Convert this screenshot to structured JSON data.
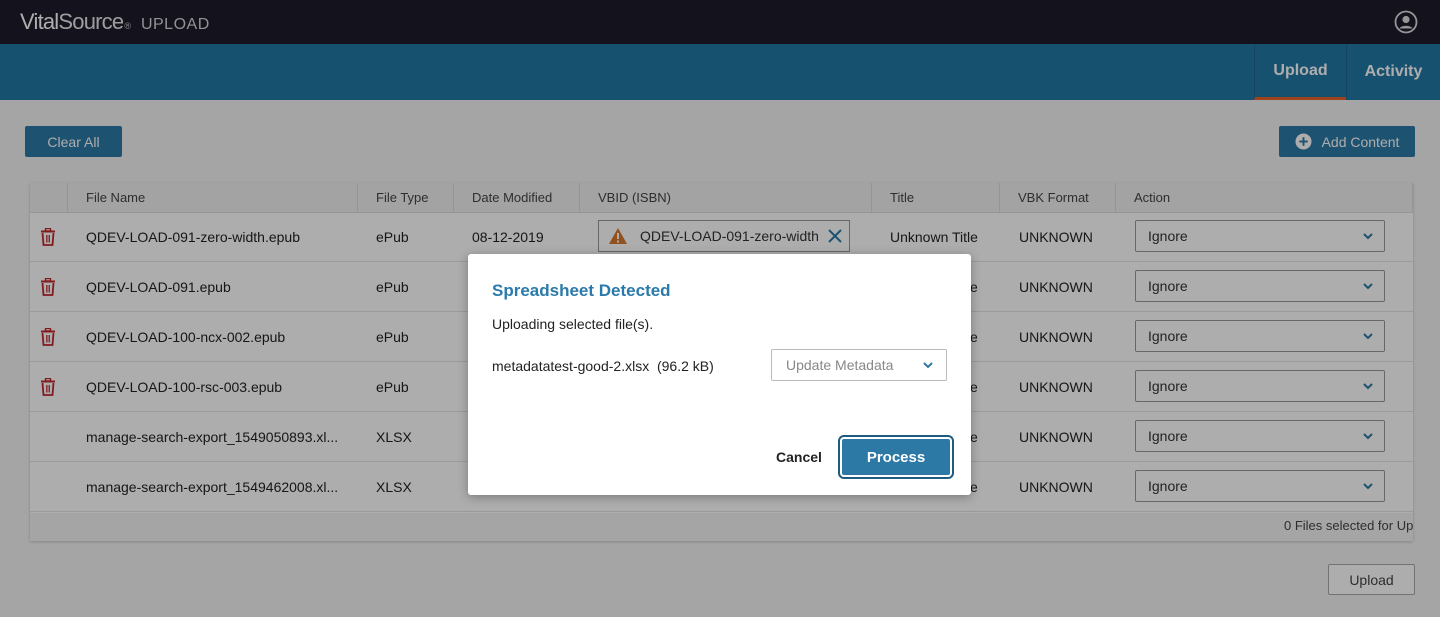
{
  "app": {
    "brand_vital": "Vital",
    "brand_source": "Source",
    "brand_tm": "®",
    "product": "UPLOAD"
  },
  "nav": {
    "tabs": [
      {
        "label": "Upload",
        "active": true
      },
      {
        "label": "Activity",
        "active": false
      }
    ]
  },
  "toolbar": {
    "clear_all_label": "Clear All",
    "add_content_label": "Add Content"
  },
  "table": {
    "columns": [
      "File Name",
      "File Type",
      "Date Modified",
      "VBID (ISBN)",
      "Title",
      "VBK Format",
      "Action"
    ],
    "rows": [
      {
        "file_name": "QDEV-LOAD-091-zero-width.epub",
        "file_type": "ePub",
        "date_modified": "08-12-2019",
        "vbid": "QDEV-LOAD-091-zero-width",
        "title": "Unknown Title",
        "vbk_format": "UNKNOWN",
        "action": "Ignore",
        "deletable": true
      },
      {
        "file_name": "QDEV-LOAD-091.epub",
        "file_type": "ePub",
        "date_modified": "",
        "vbid": "",
        "title": "e",
        "vbk_format": "UNKNOWN",
        "action": "Ignore",
        "deletable": true
      },
      {
        "file_name": "QDEV-LOAD-100-ncx-002.epub",
        "file_type": "ePub",
        "date_modified": "",
        "vbid": "",
        "title": "e",
        "vbk_format": "UNKNOWN",
        "action": "Ignore",
        "deletable": true
      },
      {
        "file_name": "QDEV-LOAD-100-rsc-003.epub",
        "file_type": "ePub",
        "date_modified": "",
        "vbid": "",
        "title": "e",
        "vbk_format": "UNKNOWN",
        "action": "Ignore",
        "deletable": true
      },
      {
        "file_name": "manage-search-export_1549050893.xl...",
        "file_type": "XLSX",
        "date_modified": "",
        "vbid": "",
        "title": "e",
        "vbk_format": "UNKNOWN",
        "action": "Ignore",
        "deletable": false
      },
      {
        "file_name": "manage-search-export_1549462008.xl...",
        "file_type": "XLSX",
        "date_modified": "",
        "vbid": "",
        "title": "e",
        "vbk_format": "UNKNOWN",
        "action": "Ignore",
        "deletable": false
      }
    ],
    "footer_status": "0 Files selected for Up"
  },
  "upload_button_label": "Upload",
  "modal": {
    "title": "Spreadsheet Detected",
    "message": "Uploading selected file(s).",
    "file_label": "metadatatest-good-2.xlsx  (96.2 kB)",
    "select_placeholder": "Update Metadata",
    "cancel_label": "Cancel",
    "process_label": "Process"
  },
  "colors": {
    "topbar": "#1c1b2b",
    "navbar": "#2378a5",
    "accent_tab": "#e8632b",
    "primary_button": "#2c79a6",
    "trash_red": "#c0272d",
    "warning_orange": "#d9782c"
  }
}
